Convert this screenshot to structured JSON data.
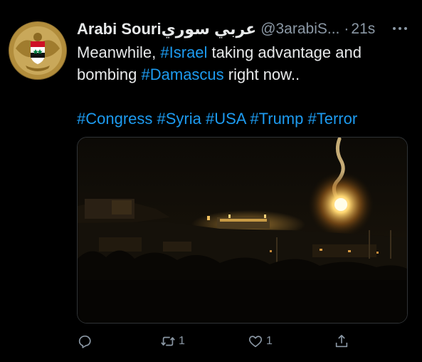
{
  "tweet": {
    "display_name": "Arabi Souriعربي سوري",
    "handle": "@3arabiS...",
    "separator": "·",
    "time": "21s",
    "text": {
      "line1_prefix": "Meanwhile, ",
      "line1_tag": "#Israel",
      "line1_suffix": " taking advantage and",
      "line2_prefix": "bombing ",
      "line2_tag": "#Damascus",
      "line2_suffix": " right now..",
      "hashtags": [
        "#Congress",
        "#Syria",
        "#USA",
        "#Trump",
        "#Terror"
      ]
    }
  },
  "actions": {
    "reply": {
      "icon": "reply-icon",
      "count": ""
    },
    "retweet": {
      "icon": "retweet-icon",
      "count": "1"
    },
    "like": {
      "icon": "heart-icon",
      "count": "1"
    },
    "share": {
      "icon": "share-icon",
      "count": ""
    }
  },
  "colors": {
    "background": "#000000",
    "text": "#e7e9ea",
    "secondary": "#8b98a5",
    "link": "#1d9bf0"
  }
}
